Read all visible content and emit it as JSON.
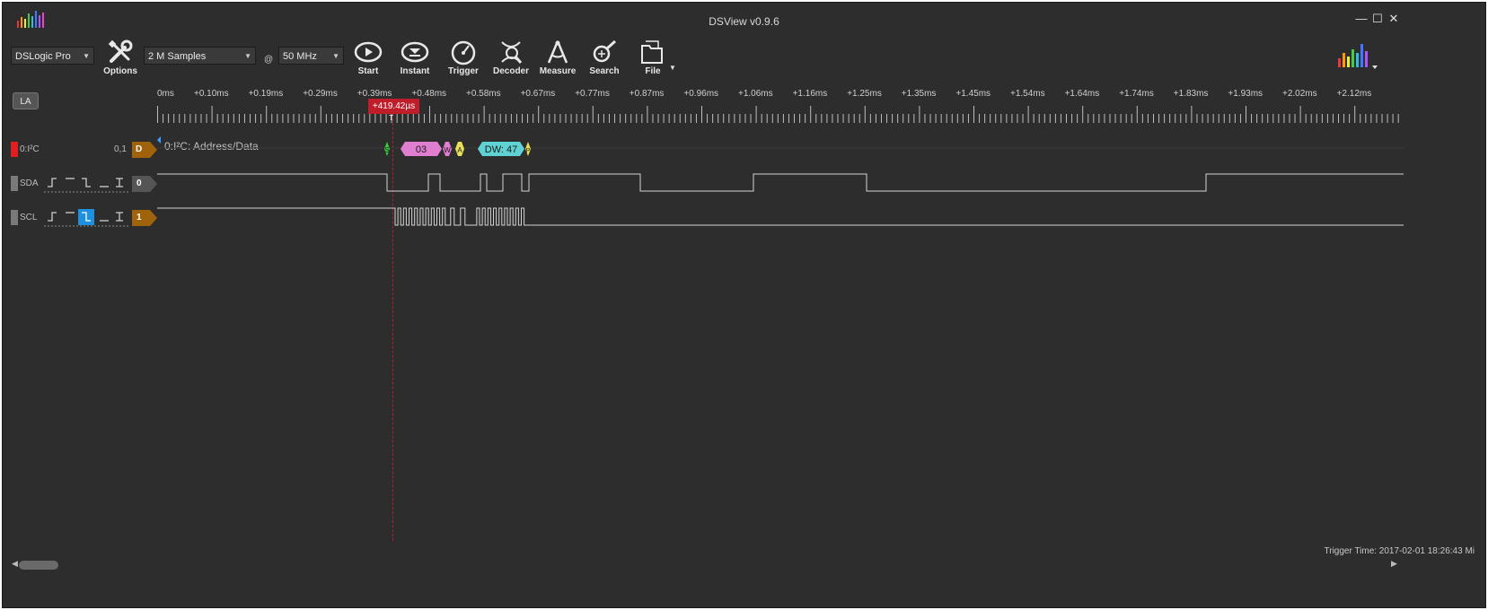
{
  "window": {
    "title": "DSView v0.9.6",
    "controls": [
      "—",
      "☐",
      "✕"
    ]
  },
  "toolbar": {
    "device": "DSLogic Pro",
    "samples": "2 M Samples",
    "at": "@",
    "rate": "50 MHz",
    "options": "Options",
    "start": "Start",
    "instant": "Instant",
    "trigger": "Trigger",
    "decoder": "Decoder",
    "measure": "Measure",
    "search": "Search",
    "file": "File"
  },
  "mode_button": "LA",
  "ruler": {
    "labels": [
      "+0.00ms",
      "+0.10ms",
      "+0.19ms",
      "+0.29ms",
      "+0.39ms",
      "+0.48ms",
      "+0.58ms",
      "+0.67ms",
      "+0.77ms",
      "+0.87ms",
      "+0.96ms",
      "+1.06ms",
      "+1.16ms",
      "+1.25ms",
      "+1.35ms",
      "+1.45ms",
      "+1.54ms",
      "+1.64ms",
      "+1.74ms",
      "+1.83ms",
      "+1.93ms",
      "+2.02ms",
      "+2.12ms"
    ],
    "first_label_visible": "0ms",
    "cursor": "+419.42µs",
    "cursor_marker": "T"
  },
  "channels": {
    "decoder": {
      "name": "0:I²C",
      "extra": "0,1",
      "tag": "D",
      "tag_color": "#a0620a",
      "color": "#e02020",
      "row_label": "0:I²C: Address/Data"
    },
    "sda": {
      "name": "SDA",
      "tag": "0",
      "tag_color": "#555555",
      "color": "#7a7a7a"
    },
    "scl": {
      "name": "SCL",
      "tag": "1",
      "tag_color": "#a0620a",
      "color": "#7a7a7a"
    }
  },
  "decoded": {
    "start": "S",
    "address": "03",
    "rw": "W",
    "ack1": "A",
    "data": "DW: 47",
    "end": "P"
  },
  "colors": {
    "background": "#2d2d2d",
    "address": "#e07ed0",
    "data": "#5fd3d3",
    "start": "#3fd03f",
    "ack": "#e8e05a",
    "cursor": "#c01d2a",
    "trigger_active": "#1e90e0"
  },
  "trigger_time": "Trigger Time: 2017-02-01 18:26:43 Mi"
}
